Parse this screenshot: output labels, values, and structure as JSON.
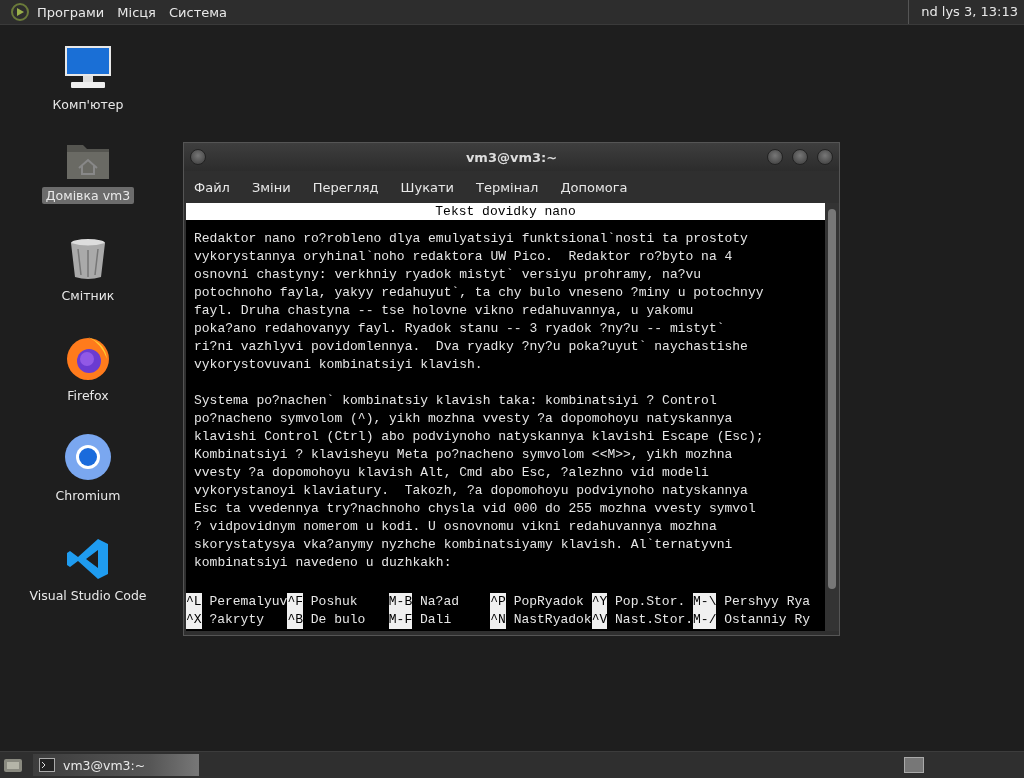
{
  "top_panel": {
    "menus": [
      "Програми",
      "Місця",
      "Система"
    ],
    "clock": "nd lys 3, 13:13"
  },
  "desktop_icons": [
    {
      "kind": "computer",
      "label": "Комп'ютер",
      "selected": false
    },
    {
      "kind": "home",
      "label": "Домівка vm3",
      "selected": true
    },
    {
      "kind": "trash",
      "label": "Смітник",
      "selected": false
    },
    {
      "kind": "firefox",
      "label": "Firefox",
      "selected": false
    },
    {
      "kind": "chromium",
      "label": "Chromium",
      "selected": false
    },
    {
      "kind": "vscode",
      "label": "Visual Studio Code",
      "selected": false
    }
  ],
  "terminal": {
    "title": "vm3@vm3:~",
    "menus": [
      "Файл",
      "Зміни",
      "Перегляд",
      "Шукати",
      "Термінал",
      "Допомога"
    ],
    "nano": {
      "header": "Tekst dovidky nano",
      "paragraphs": [
        [
          "Redaktor nano ro?robleno dlya emulyatsiyi funktsional`nosti ta prostoty",
          "vykorystannya oryhinal`noho redaktora UW Pico.  Redaktor ro?byto na 4",
          "osnovni chastyny: verkhniy ryadok mistyt` versiyu prohramy, na?vu",
          "potochnoho fayla, yakyy redahuyut`, ta chy bulo vneseno ?miny u potochnyy",
          "fayl. Druha chastyna -- tse holovne vikno redahuvannya, u yakomu",
          "poka?ano redahovanyy fayl. Ryadok stanu -- 3 ryadok ?ny?u -- mistyt`",
          "ri?ni vazhlyvi povidomlennya.  Dva ryadky ?ny?u poka?uyut` naychastishe",
          "vykorystovuvani kombinatsiyi klavish."
        ],
        [
          "Systema po?nachen` kombinatsiy klavish taka: kombinatsiyi ? Control",
          "po?nacheno symvolom (^), yikh mozhna vvesty ?a dopomohoyu natyskannya",
          "klavishi Control (Ctrl) abo podviynoho natyskannya klavishi Escape (Esc);",
          "Kombinatsiyi ? klavisheyu Meta po?nacheno symvolom <<M>>, yikh mozhna",
          "vvesty ?a dopomohoyu klavish Alt, Cmd abo Esc, ?alezhno vid modeli",
          "vykorystanoyi klaviatury.  Takozh, ?a dopomohoyu podviynoho natyskannya",
          "Esc ta vvedennya try?nachnoho chysla vid 000 do 255 mozhna vvesty symvol",
          "? vidpovidnym nomerom u kodi. U osnovnomu vikni redahuvannya mozhna",
          "skorystatysya vka?anymy nyzhche kombinatsiyamy klavish. Al`ternatyvni",
          "kombinatsiyi navedeno u duzhkakh:"
        ]
      ],
      "shortcuts": [
        [
          {
            "key": "^L",
            "label": "Peremalyuv"
          },
          {
            "key": "^F",
            "label": "Poshuk"
          },
          {
            "key": "M-B",
            "label": "Na?ad"
          },
          {
            "key": "^P",
            "label": "PopRyadok"
          },
          {
            "key": "^Y",
            "label": "Pop.Stor."
          },
          {
            "key": "M-\\",
            "label": "Pershyy Rya"
          }
        ],
        [
          {
            "key": "^X",
            "label": "?akryty"
          },
          {
            "key": "^B",
            "label": "De bulo"
          },
          {
            "key": "M-F",
            "label": "Dali"
          },
          {
            "key": "^N",
            "label": "NastRyadok"
          },
          {
            "key": "^V",
            "label": "Nast.Stor."
          },
          {
            "key": "M-/",
            "label": "Ostanniy Ry"
          }
        ]
      ]
    }
  },
  "taskbar": {
    "tasks": [
      {
        "label": "vm3@vm3:~",
        "selected": true
      }
    ]
  }
}
